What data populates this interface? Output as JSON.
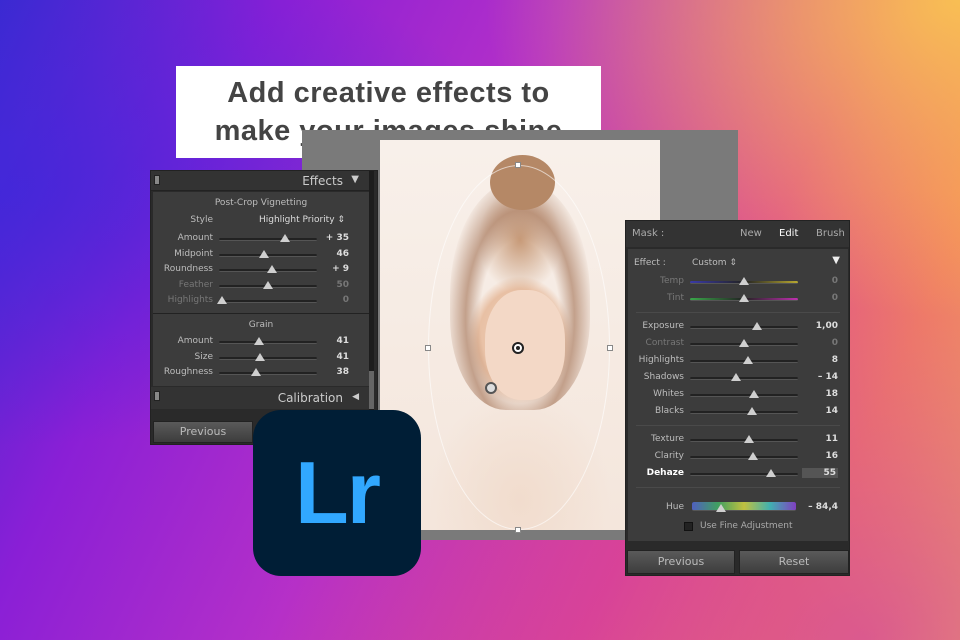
{
  "headline": {
    "line1": "Add creative effects to",
    "line2": "make your images shine"
  },
  "effects_panel": {
    "title": "Effects",
    "collapse_icon": "triangle-down-icon",
    "vignetting": {
      "title": "Post-Crop Vignetting",
      "style_label": "Style",
      "style_value": "Highlight Priority ⇕",
      "sliders": [
        {
          "label": "Amount",
          "value": "+ 35",
          "pos": 0.67
        },
        {
          "label": "Midpoint",
          "value": "46",
          "pos": 0.46
        },
        {
          "label": "Roundness",
          "value": "+ 9",
          "pos": 0.54
        },
        {
          "label": "Feather",
          "value": "50",
          "pos": 0.5,
          "dim": true
        },
        {
          "label": "Highlights",
          "value": "0",
          "pos": 0.03,
          "dim": true
        }
      ]
    },
    "grain": {
      "title": "Grain",
      "sliders": [
        {
          "label": "Amount",
          "value": "41",
          "pos": 0.41
        },
        {
          "label": "Size",
          "value": "41",
          "pos": 0.42
        },
        {
          "label": "Roughness",
          "value": "38",
          "pos": 0.38
        }
      ]
    },
    "calibration": "Calibration",
    "previous": "Previous"
  },
  "mask_panel": {
    "mask_label": "Mask :",
    "new": "New",
    "edit": "Edit",
    "brush": "Brush",
    "effect_label": "Effect :",
    "effect_value": "Custom ⇕",
    "groups": [
      [
        {
          "label": "Temp",
          "value": "0",
          "pos": 0.5,
          "track": "temp",
          "dim": true
        },
        {
          "label": "Tint",
          "value": "0",
          "pos": 0.5,
          "track": "tint",
          "dim": true
        }
      ],
      [
        {
          "label": "Exposure",
          "value": "1,00",
          "pos": 0.62
        },
        {
          "label": "Contrast",
          "value": "0",
          "pos": 0.5,
          "dim": true
        },
        {
          "label": "Highlights",
          "value": "8",
          "pos": 0.54
        },
        {
          "label": "Shadows",
          "value": "– 14",
          "pos": 0.43
        },
        {
          "label": "Whites",
          "value": "18",
          "pos": 0.59
        },
        {
          "label": "Blacks",
          "value": "14",
          "pos": 0.57
        }
      ],
      [
        {
          "label": "Texture",
          "value": "11",
          "pos": 0.55
        },
        {
          "label": "Clarity",
          "value": "16",
          "pos": 0.58
        },
        {
          "label": "Dehaze",
          "value": "55",
          "pos": 0.75,
          "highlight": true
        }
      ]
    ],
    "hue": {
      "label": "Hue",
      "value": "– 84,4",
      "pos": 0.28
    },
    "fine_adjustment": "Use Fine Adjustment",
    "previous": "Previous",
    "reset": "Reset"
  },
  "logo": {
    "text": "Lr"
  }
}
